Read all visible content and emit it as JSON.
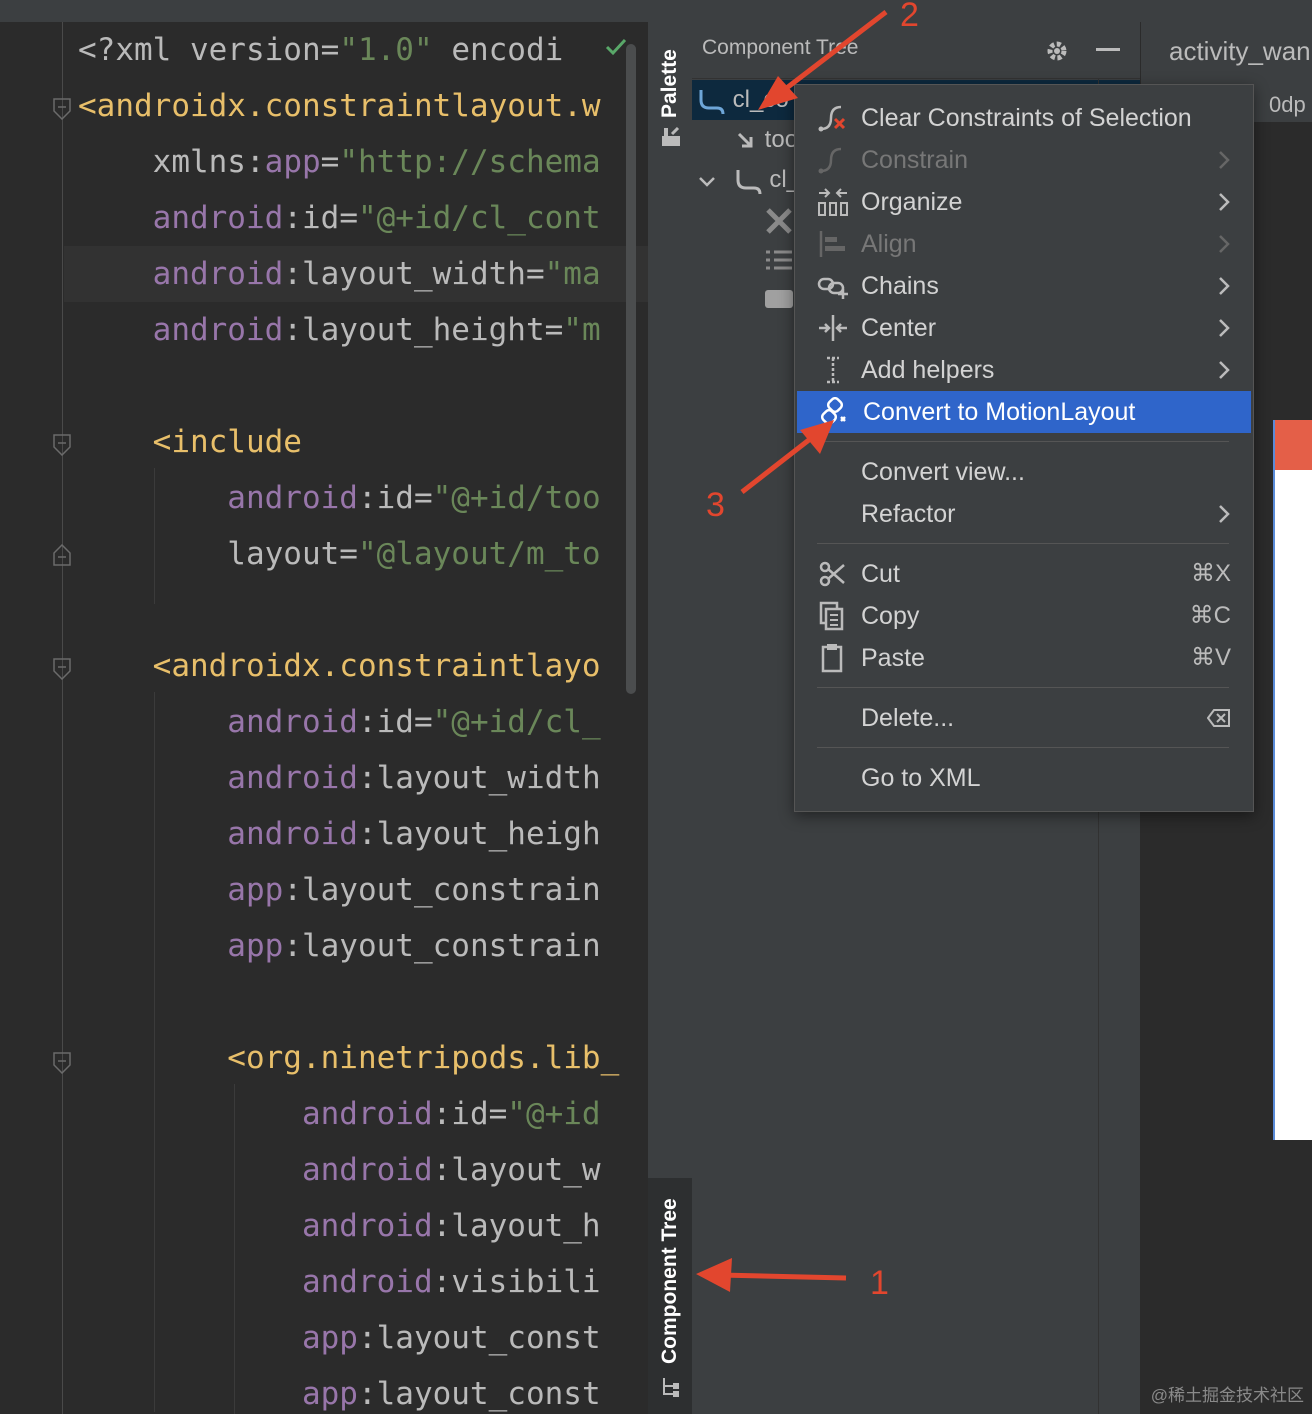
{
  "editor": {
    "lines": [
      {
        "segments": [
          [
            "t-pi",
            "<?xml "
          ],
          [
            "t-attr",
            "version"
          ],
          [
            "t-pi",
            "="
          ],
          [
            "t-str",
            "\"1.0\""
          ],
          [
            "t-pi",
            " "
          ],
          [
            "t-attr",
            "encodi"
          ]
        ]
      },
      {
        "segments": [
          [
            "t-tag",
            "<androidx.constraintlayout.w"
          ]
        ]
      },
      {
        "segments": [
          [
            "t-attr",
            "    xmlns"
          ],
          [
            "t-pi",
            ":"
          ],
          [
            "t-ns",
            "app"
          ],
          [
            "t-pi",
            "="
          ],
          [
            "t-str",
            "\"http://schema"
          ]
        ]
      },
      {
        "segments": [
          [
            "t-ns",
            "    android"
          ],
          [
            "t-pi",
            ":"
          ],
          [
            "t-attr",
            "id"
          ],
          [
            "t-pi",
            "="
          ],
          [
            "t-str",
            "\"@+id/cl_cont"
          ]
        ]
      },
      {
        "segments": [
          [
            "t-ns",
            "    android"
          ],
          [
            "t-pi",
            ":"
          ],
          [
            "t-attr",
            "layout_width"
          ],
          [
            "t-pi",
            "="
          ],
          [
            "t-str",
            "\"ma"
          ]
        ]
      },
      {
        "segments": [
          [
            "t-ns",
            "    android"
          ],
          [
            "t-pi",
            ":"
          ],
          [
            "t-attr",
            "layout_height"
          ],
          [
            "t-pi",
            "="
          ],
          [
            "t-str",
            "\"m"
          ]
        ]
      },
      {
        "segments": []
      },
      {
        "segments": [
          [
            "t-tag",
            "    <include"
          ]
        ]
      },
      {
        "segments": [
          [
            "t-ns",
            "        android"
          ],
          [
            "t-pi",
            ":"
          ],
          [
            "t-attr",
            "id"
          ],
          [
            "t-pi",
            "="
          ],
          [
            "t-str",
            "\"@+id/too"
          ]
        ]
      },
      {
        "segments": [
          [
            "t-attr",
            "        layout"
          ],
          [
            "t-pi",
            "="
          ],
          [
            "t-str",
            "\"@layout/m_to"
          ]
        ]
      },
      {
        "segments": []
      },
      {
        "segments": [
          [
            "t-tag",
            "    <androidx.constraintlayo"
          ]
        ]
      },
      {
        "segments": [
          [
            "t-ns",
            "        android"
          ],
          [
            "t-pi",
            ":"
          ],
          [
            "t-attr",
            "id"
          ],
          [
            "t-pi",
            "="
          ],
          [
            "t-str",
            "\"@+id/cl_"
          ]
        ]
      },
      {
        "segments": [
          [
            "t-ns",
            "        android"
          ],
          [
            "t-pi",
            ":"
          ],
          [
            "t-attr",
            "layout_width"
          ]
        ]
      },
      {
        "segments": [
          [
            "t-ns",
            "        android"
          ],
          [
            "t-pi",
            ":"
          ],
          [
            "t-attr",
            "layout_heigh"
          ]
        ]
      },
      {
        "segments": [
          [
            "t-ns",
            "        app"
          ],
          [
            "t-pi",
            ":"
          ],
          [
            "t-attr",
            "layout_constrain"
          ]
        ]
      },
      {
        "segments": [
          [
            "t-ns",
            "        app"
          ],
          [
            "t-pi",
            ":"
          ],
          [
            "t-attr",
            "layout_constrain"
          ]
        ]
      },
      {
        "segments": []
      },
      {
        "segments": [
          [
            "t-tag",
            "        <org.ninetripods.lib_"
          ]
        ]
      },
      {
        "segments": [
          [
            "t-ns",
            "            android"
          ],
          [
            "t-pi",
            ":"
          ],
          [
            "t-attr",
            "id"
          ],
          [
            "t-pi",
            "="
          ],
          [
            "t-str",
            "\"@+id"
          ]
        ]
      },
      {
        "segments": [
          [
            "t-ns",
            "            android"
          ],
          [
            "t-pi",
            ":"
          ],
          [
            "t-attr",
            "layout_w"
          ]
        ]
      },
      {
        "segments": [
          [
            "t-ns",
            "            android"
          ],
          [
            "t-pi",
            ":"
          ],
          [
            "t-attr",
            "layout_h"
          ]
        ]
      },
      {
        "segments": [
          [
            "t-ns",
            "            android"
          ],
          [
            "t-pi",
            ":"
          ],
          [
            "t-attr",
            "visibili"
          ]
        ]
      },
      {
        "segments": [
          [
            "t-ns",
            "            app"
          ],
          [
            "t-pi",
            ":"
          ],
          [
            "t-attr",
            "layout_const"
          ]
        ]
      },
      {
        "segments": [
          [
            "t-ns",
            "            app"
          ],
          [
            "t-pi",
            ":"
          ],
          [
            "t-attr",
            "layout_const"
          ]
        ]
      }
    ]
  },
  "strip": {
    "palette_label": "Palette",
    "component_tree_label": "Component Tree"
  },
  "tree": {
    "title": "Component Tree",
    "rows": [
      "cl_co",
      "too",
      "cl_"
    ]
  },
  "design": {
    "file_tab": "activity_wan",
    "dimension": "0dp"
  },
  "menu": {
    "items": [
      {
        "label": "Clear Constraints of Selection",
        "icon": "clear-constraints-icon",
        "submenu": false,
        "disabled": false
      },
      {
        "label": "Constrain",
        "icon": "constrain-icon",
        "submenu": true,
        "disabled": true
      },
      {
        "label": "Organize",
        "icon": "organize-icon",
        "submenu": true,
        "disabled": false
      },
      {
        "label": "Align",
        "icon": "align-icon",
        "submenu": true,
        "disabled": true
      },
      {
        "label": "Chains",
        "icon": "chains-icon",
        "submenu": true,
        "disabled": false
      },
      {
        "label": "Center",
        "icon": "center-icon",
        "submenu": true,
        "disabled": false
      },
      {
        "label": "Add helpers",
        "icon": "add-helpers-icon",
        "submenu": true,
        "disabled": false
      },
      {
        "label": "Convert to MotionLayout",
        "icon": "motion-layout-icon",
        "submenu": false,
        "disabled": false,
        "active": true
      }
    ],
    "convert_view": "Convert view...",
    "refactor": "Refactor",
    "cut": "Cut",
    "cut_sc": "⌘X",
    "copy": "Copy",
    "copy_sc": "⌘C",
    "paste": "Paste",
    "paste_sc": "⌘V",
    "delete": "Delete...",
    "goto_xml": "Go to XML"
  },
  "annotations": {
    "one": "1",
    "two": "2",
    "three": "3",
    "color": "#e2462e"
  },
  "watermark": "@稀土掘金技术社区"
}
